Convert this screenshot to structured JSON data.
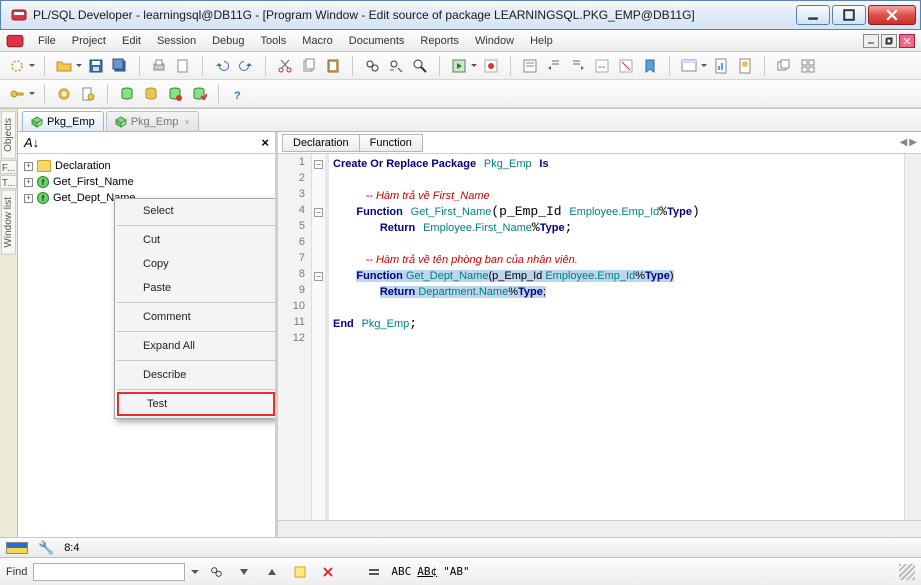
{
  "titlebar": {
    "title": "PL/SQL Developer - learningsql@DB11G - [Program Window - Edit source of package LEARNINGSQL.PKG_EMP@DB11G]"
  },
  "menu": {
    "items": [
      "File",
      "Project",
      "Edit",
      "Session",
      "Debug",
      "Tools",
      "Macro",
      "Documents",
      "Reports",
      "Window",
      "Help"
    ]
  },
  "side_tabs": [
    "Objects",
    "F...",
    "T...",
    "Window list"
  ],
  "doc_tabs": [
    {
      "label": "Pkg_Emp",
      "active": true
    },
    {
      "label": "Pkg_Emp",
      "active": false
    }
  ],
  "tree": {
    "items": [
      {
        "kind": "folder",
        "label": "Declaration",
        "expander": "+"
      },
      {
        "kind": "fn",
        "label": "Get_First_Name",
        "expander": "+"
      },
      {
        "kind": "fn",
        "label": "Get_Dept_Name",
        "expander": "+",
        "selected": true
      }
    ]
  },
  "context_menu": {
    "items": [
      "Select",
      "Cut",
      "Copy",
      "Paste",
      "Comment",
      "Expand All",
      "Describe",
      "Test"
    ],
    "highlighted": "Test"
  },
  "breadcrumb": [
    "Declaration",
    "Function"
  ],
  "code_lines": [
    "1",
    "2",
    "3",
    "4",
    "5",
    "6",
    "7",
    "8",
    "9",
    "10",
    "11",
    "12"
  ],
  "code": {
    "l1": "Create Or Replace Package Pkg_Emp Is",
    "l2": "",
    "l3": "   -- Hàm trả về First_Name",
    "l4": "   Function Get_First_Name(p_Emp_Id Employee.Emp_Id%Type)",
    "l5": "      Return Employee.First_Name%Type;",
    "l6": "",
    "l7": "   -- Hàm trả về tên phòng ban của nhân viên.",
    "l8": "   Function Get_Dept_Name(p_Emp_Id Employee.Emp_Id%Type)",
    "l9": "      Return Department.Name%Type;",
    "l10": "",
    "l11": "End Pkg_Emp;",
    "l12": ""
  },
  "status": {
    "pos": "8:4"
  },
  "findbar": {
    "label": "Find",
    "value": "",
    "sample": "\"AB\""
  }
}
